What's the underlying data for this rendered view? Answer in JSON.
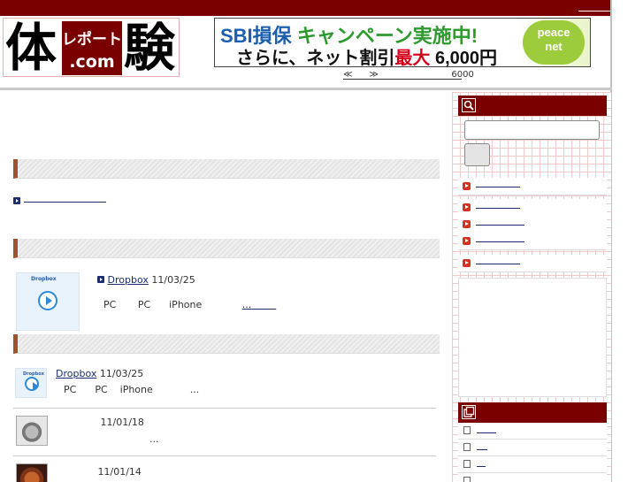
{
  "logo": {
    "kanji_left": "体",
    "center_top": "レポート",
    "center_bottom": ".com",
    "kanji_right": "験"
  },
  "banner": {
    "line1_brand": "SBI損保",
    "line1_text": " キャンペーン実施中!",
    "line2_text": "さらに、ネット割引",
    "line2_emph": "最大",
    "line2_amount": "6,000円",
    "badge_line1": "peace",
    "badge_line2": "net"
  },
  "nav": {
    "prev": "≪",
    "next": "≫",
    "count": "6000"
  },
  "sections": {
    "s1": "",
    "s2": "",
    "s3": ""
  },
  "featured": {
    "title": "Dropbox",
    "date": "11/03/25",
    "body_a": "PC",
    "body_b": "PC",
    "body_c": "iPhone",
    "more": "...",
    "thumb_label": "Dropbox"
  },
  "items": [
    {
      "title": "Dropbox",
      "date": "11/03/25",
      "desc_a": "PC",
      "desc_b": "PC",
      "desc_c": "iPhone",
      "desc_more": "...",
      "thumb_label": "Dropbox"
    },
    {
      "title": "",
      "date": "11/01/18",
      "desc_more": "..."
    },
    {
      "title": "",
      "date": "11/01/14"
    }
  ],
  "colors": {
    "brand": "#7a0000",
    "link": "#1a2e6e",
    "section_accent": "#a0522d"
  },
  "icons": {
    "search": "magnifier-icon",
    "recent": "pages-icon"
  }
}
